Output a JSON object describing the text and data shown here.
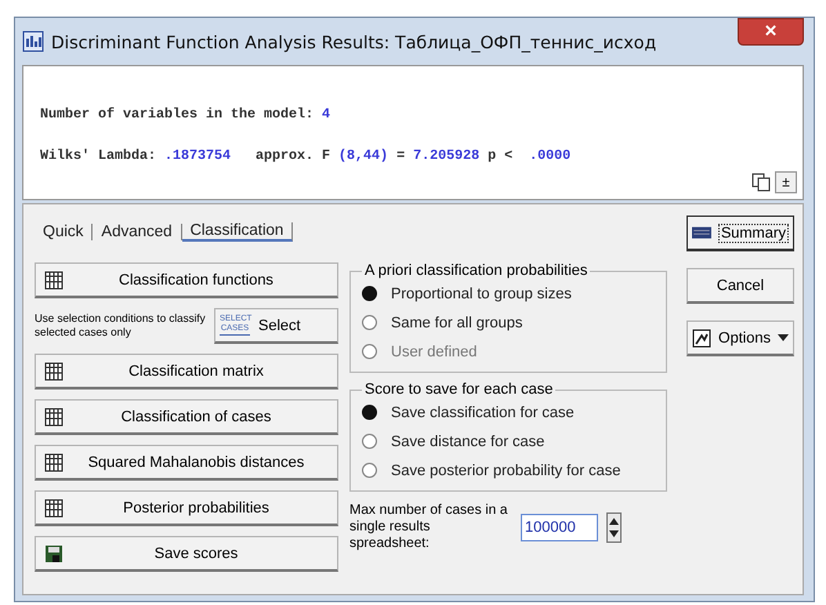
{
  "window": {
    "title": "Discriminant Function Analysis Results: Таблица_ОФП_теннис_исход",
    "close": "×"
  },
  "output": {
    "lines": [
      [
        {
          "kind": "label",
          "text": "Number of variables in the model: "
        },
        {
          "kind": "value",
          "text": "4"
        }
      ],
      [
        {
          "kind": "label",
          "text": "Wilks' Lambda: "
        },
        {
          "kind": "value",
          "text": ".1873754"
        },
        {
          "kind": "label",
          "text": "   approx. F "
        },
        {
          "kind": "value",
          "text": "(8,44)"
        },
        {
          "kind": "label",
          "text": " = "
        },
        {
          "kind": "value",
          "text": "7.205928"
        },
        {
          "kind": "label",
          "text": " p < "
        },
        {
          "kind": "value",
          "text": " .0000"
        }
      ]
    ],
    "expand_button": "±"
  },
  "tabs": [
    {
      "label": "Quick",
      "selected": false
    },
    {
      "label": "Advanced",
      "selected": false
    },
    {
      "label": "Classification",
      "selected": true
    }
  ],
  "left_buttons": [
    {
      "kind": "button",
      "label": "Classification functions"
    },
    {
      "kind": "select",
      "note": "Use selection conditions to classify selected cases only",
      "badge": "SELECT CASES",
      "label": "Select"
    },
    {
      "kind": "button",
      "label": "Classification matrix"
    },
    {
      "kind": "button",
      "label": "Classification of cases"
    },
    {
      "kind": "button",
      "label": "Squared Mahalanobis distances"
    },
    {
      "kind": "button",
      "label": "Posterior probabilities"
    },
    {
      "kind": "save",
      "label": "Save scores"
    }
  ],
  "groups": [
    {
      "title": "A priori classification probabilities",
      "options": [
        {
          "label": "Proportional to group sizes",
          "selected": true,
          "disabled": false
        },
        {
          "label": "Same for all groups",
          "selected": false,
          "disabled": false
        },
        {
          "label": "User defined",
          "selected": false,
          "disabled": true
        }
      ]
    },
    {
      "title": "Score to save for each case",
      "options": [
        {
          "label": "Save classification for case",
          "selected": true,
          "disabled": false
        },
        {
          "label": "Save distance for case",
          "selected": false,
          "disabled": false
        },
        {
          "label": "Save posterior probability for case",
          "selected": false,
          "disabled": false
        }
      ]
    }
  ],
  "max_cases": {
    "label": "Max number of cases in a single results spreadsheet:",
    "value": "100000"
  },
  "right_buttons": [
    {
      "kind": "summary",
      "label": "Summary"
    },
    {
      "kind": "plain",
      "label": "Cancel"
    },
    {
      "kind": "options",
      "label": "Options"
    }
  ]
}
